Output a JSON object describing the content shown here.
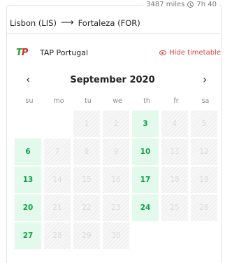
{
  "trip": {
    "distance": "3487 miles",
    "duration": "7h 40",
    "origin": "Lisbon (LIS)",
    "arrow": "⟶",
    "destination": "Fortaleza (FOR)"
  },
  "airline": {
    "logo_t": "T",
    "logo_p": "P",
    "name": "TAP Portugal",
    "hide_timetable_label": "Hide timetable"
  },
  "calendar": {
    "month_label": "September 2020",
    "prev_icon": "‹",
    "next_icon": "›",
    "weekdays": [
      "su",
      "mo",
      "tu",
      "we",
      "th",
      "fr",
      "sa"
    ],
    "leading_empty": 2,
    "days": [
      {
        "day": "1",
        "available": false
      },
      {
        "day": "2",
        "available": false
      },
      {
        "day": "3",
        "available": true
      },
      {
        "day": "4",
        "available": false
      },
      {
        "day": "5",
        "available": false
      },
      {
        "day": "6",
        "available": true
      },
      {
        "day": "7",
        "available": false
      },
      {
        "day": "8",
        "available": false
      },
      {
        "day": "9",
        "available": false
      },
      {
        "day": "10",
        "available": true
      },
      {
        "day": "11",
        "available": false
      },
      {
        "day": "12",
        "available": false
      },
      {
        "day": "13",
        "available": true
      },
      {
        "day": "14",
        "available": false
      },
      {
        "day": "15",
        "available": false
      },
      {
        "day": "16",
        "available": false
      },
      {
        "day": "17",
        "available": true
      },
      {
        "day": "18",
        "available": false
      },
      {
        "day": "19",
        "available": false
      },
      {
        "day": "20",
        "available": true
      },
      {
        "day": "21",
        "available": false
      },
      {
        "day": "22",
        "available": false
      },
      {
        "day": "23",
        "available": false
      },
      {
        "day": "24",
        "available": true
      },
      {
        "day": "25",
        "available": false
      },
      {
        "day": "26",
        "available": false
      },
      {
        "day": "27",
        "available": true
      },
      {
        "day": "28",
        "available": false
      },
      {
        "day": "29",
        "available": false
      },
      {
        "day": "30",
        "available": false
      }
    ]
  },
  "colors": {
    "available_bg": "#e3f9ec",
    "available_text": "#15a24b",
    "accent_red": "#d64545"
  }
}
